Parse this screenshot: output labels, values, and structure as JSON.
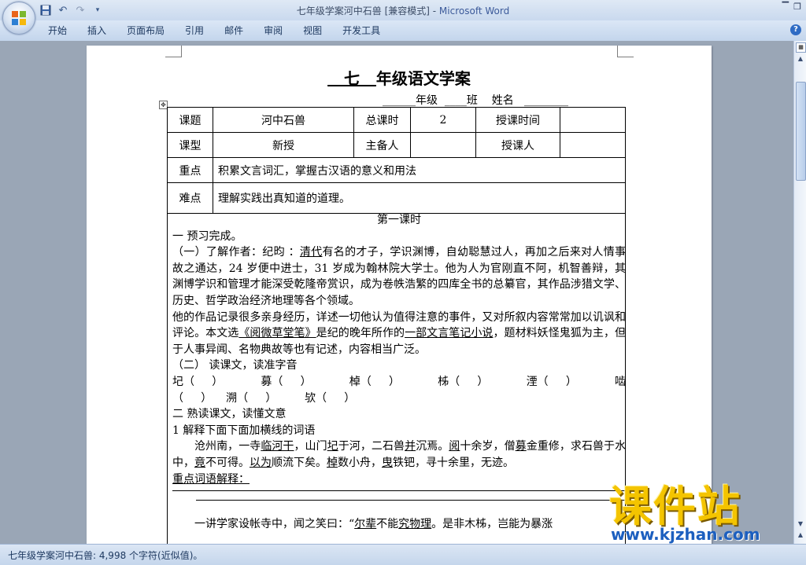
{
  "window": {
    "title": "七年级学案河中石兽 [兼容模式] - ",
    "app_name": "Microsoft Word",
    "controls": [
      "▔",
      "❐"
    ]
  },
  "quick_access": {
    "save": "save-icon",
    "undo": "undo-icon",
    "redo": "redo-icon",
    "more": "▾"
  },
  "ribbon": {
    "tabs": [
      "开始",
      "插入",
      "页面布局",
      "引用",
      "邮件",
      "审阅",
      "视图",
      "开发工具"
    ],
    "help": "?"
  },
  "document": {
    "title_grade": "七",
    "title_rest": "年级语文学案",
    "grade_line": "______年级  ____班    姓名   ________",
    "table": {
      "r1": [
        "课题",
        "河中石兽",
        "总课时",
        "2",
        "授课时间",
        ""
      ],
      "r2": [
        "课型",
        "新授",
        "主备人",
        "",
        "授课人",
        ""
      ],
      "key_label": "重点",
      "key_text": "积累文言词汇，掌握古汉语的意义和用法",
      "diff_label": "难点",
      "diff_text": "理解实践出真知道的道理。"
    },
    "session": "第一课时",
    "s1": "一 预习完成。",
    "s1a": "（一）了解作者：纪昀  ：",
    "s1a_ul": "清代",
    "s1a_rest": "有名的才子，学识渊博，自幼聪慧过人，再加之后来对人情事故之通达，24 岁便中进士，31 岁成为翰林院大学士。他为人为官刚直不阿，机智善辩，其渊博学识和管理才能深受乾隆帝赏识，成为卷帙浩繁的四库全书的总纂官，其作品涉猎文学、历史、哲学政治经济地理等各个领域。",
    "p2a": "他的作品记录很多亲身经历，详述一切他认为值得注意的事件，又对所叙内容常常加以讥讽和评论。本文选",
    "p2_ul1": "《阅微草堂笔》",
    "p2b": "是纪的晚年所作的",
    "p2_ul2": "一部文言笔记小说",
    "p2c": "，题材料妖怪鬼狐为主，但于人事异闻、名物典故等也有记述，内容相当广泛。",
    "s1b": "（二） 读课文，读准字音",
    "pron1": [
      "圮（     ）",
      "募（     ）",
      "棹（     ）",
      "柹（     ）",
      "湮（     ）",
      "啮"
    ],
    "pron2": [
      "（     ）",
      "溯（     ）",
      "欤（     ）"
    ],
    "s2": "二 熟读课文，读懂文意",
    "s2a": "1   解释下面下面加横线的词语",
    "p3_a": "沧州南，一寺",
    "p3_u1": "临河干",
    "p3_b": "，山门",
    "p3_u2": "圮",
    "p3_c": "于河，二石兽",
    "p3_u3": "并",
    "p3_d": "沉焉。",
    "p3_u4": "阅",
    "p3_e": "十余岁，僧",
    "p3_u5": "募",
    "p3_f": "金重修，求石兽于水中，",
    "p3_u6": "竟",
    "p3_g": "不可得。",
    "p3_u7": "以为",
    "p3_h": "顺流下矣。",
    "p3_u8": "棹",
    "p3_i": "数小舟，",
    "p3_u9": "曳",
    "p3_j": "铁钯，寻十余里，无迹。",
    "p3_key": "重点词语解释：",
    "p4_a": "一讲学家设帐寺中，闻之笑曰：“",
    "p4_u1": "尔辈",
    "p4_b": "不能",
    "p4_u2": "究物理",
    "p4_c": "。是非木柹，岂能为暴涨"
  },
  "status": {
    "text": "七年级学案河中石兽: 4,998 个字符(近似值)。"
  },
  "watermark": {
    "big": "课件站",
    "url": "www.kjzhan.com"
  },
  "colors": {
    "ribbon": "#c9d9ee",
    "workspace": "#9aa6b6",
    "watermark": "#f4c400",
    "url": "#1c5fbf"
  }
}
